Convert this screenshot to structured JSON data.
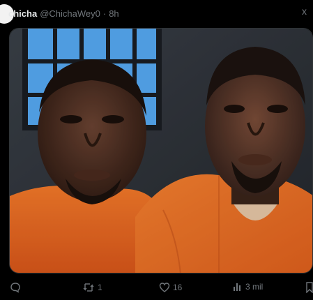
{
  "tweet": {
    "display_name": "chicha",
    "handle": "@ChichaWey0",
    "separator": "·",
    "time": "8h",
    "close_glyph": "x"
  },
  "media": {
    "alt_description": ""
  },
  "actions": {
    "reply_icon": "reply-icon",
    "retweet_icon": "retweet-icon",
    "retweet_count": "1",
    "like_icon": "heart-icon",
    "like_count": "16",
    "views_icon": "views-icon",
    "views_count": "3 mil",
    "bookmark_icon": "bookmark-icon"
  },
  "colors": {
    "background": "#000000",
    "text_primary": "#e7e9ea",
    "text_secondary": "#71767b",
    "jumpsuit_orange": "#f06a1c",
    "window_blue": "#4aa3f0"
  }
}
